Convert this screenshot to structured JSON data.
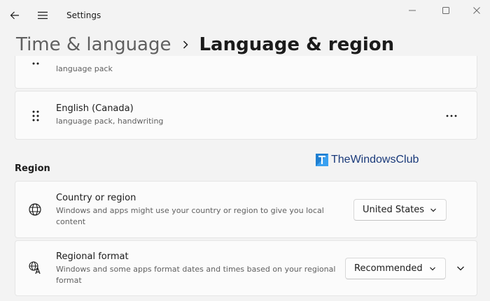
{
  "app": {
    "title": "Settings"
  },
  "icons": {
    "back": "back-arrow-icon",
    "menu": "hamburger-menu-icon",
    "minimize": "minimize-icon",
    "maximize": "maximize-icon",
    "close": "close-icon",
    "drag": "drag-handle-icon",
    "more": "more-options-icon",
    "globe": "globe-icon",
    "format": "language-format-icon",
    "chevron": "chevron-down-icon"
  },
  "breadcrumb": {
    "parent": "Time & language",
    "current": "Language & region"
  },
  "languages": [
    {
      "name": "",
      "features": "language pack"
    },
    {
      "name": "English (Canada)",
      "features": "language pack, handwriting"
    }
  ],
  "watermark": {
    "text": "TheWindowsClub"
  },
  "region": {
    "heading": "Region",
    "country": {
      "title": "Country or region",
      "description_line1": "Windows and apps might use your country or region to give you local",
      "description_line2": "content",
      "value": "United States"
    },
    "format": {
      "title": "Regional format",
      "description_line1": "Windows and some apps format dates and times based on your regional",
      "description_line2": "format",
      "value": "Recommended"
    }
  },
  "colors": {
    "background": "#f3f3f3",
    "card": "#fbfbfb",
    "watermark": "#1a3a7a",
    "logo_blue": "#1f7fd1"
  }
}
